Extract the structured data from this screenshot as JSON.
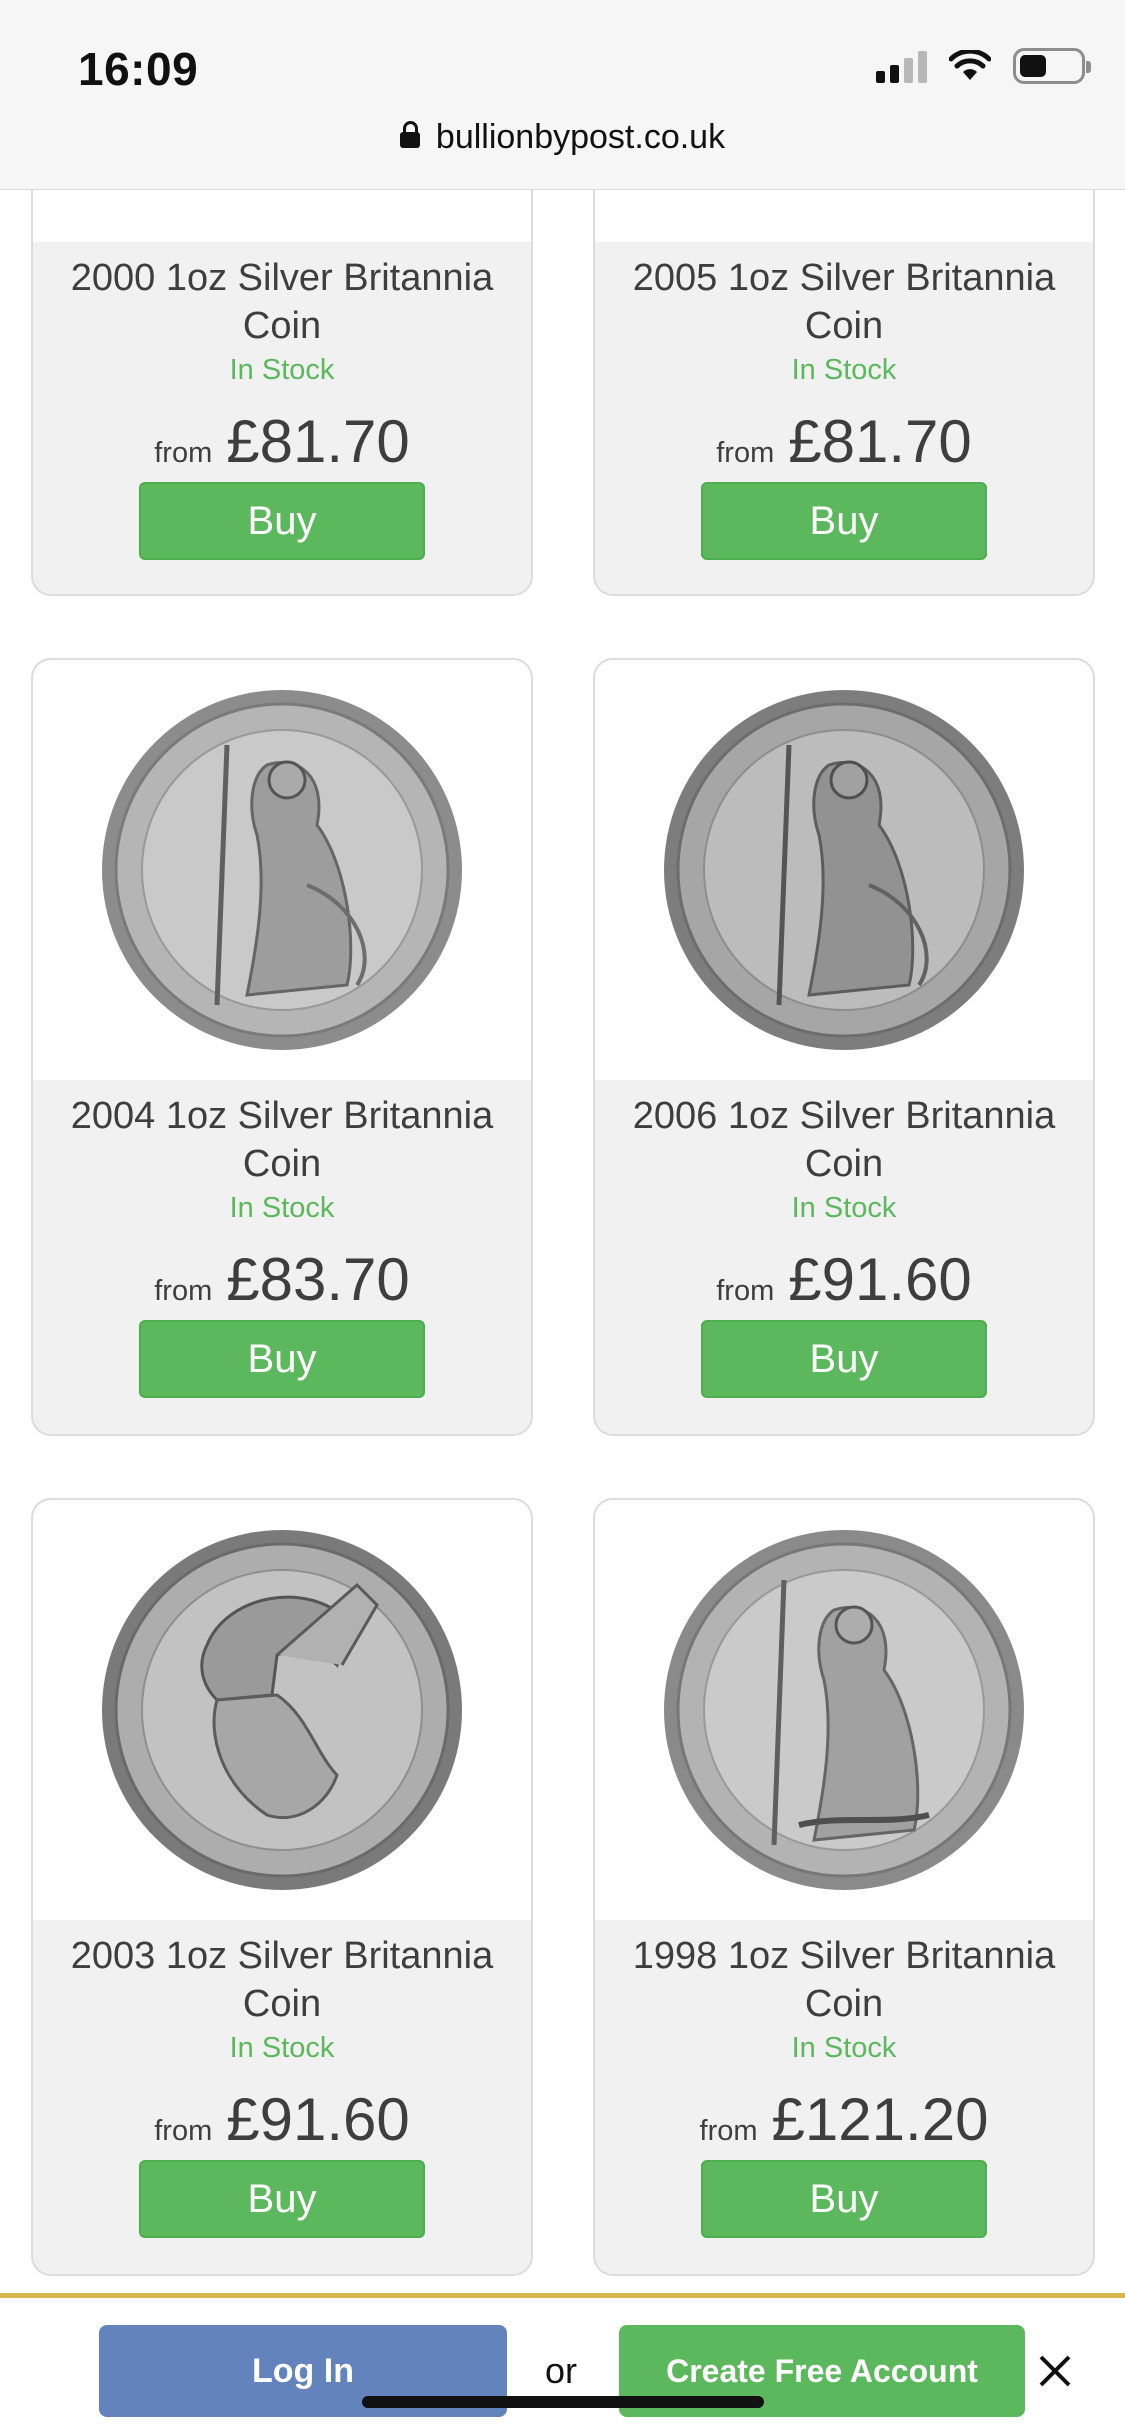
{
  "status_bar": {
    "time": "16:09"
  },
  "browser": {
    "url": "bullionbypost.co.uk"
  },
  "products": [
    {
      "title": "2000 1oz Silver Britannia Coin",
      "stock": "In Stock",
      "from_label": "from",
      "price": "£81.70",
      "buy_label": "Buy",
      "image": "britannia-standing-coin"
    },
    {
      "title": "2005 1oz Silver Britannia Coin",
      "stock": "In Stock",
      "from_label": "from",
      "price": "£81.70",
      "buy_label": "Buy",
      "image": "britannia-standing-coin"
    },
    {
      "title": "2004 1oz Silver Britannia Coin",
      "stock": "In Stock",
      "from_label": "from",
      "price": "£83.70",
      "buy_label": "Buy",
      "image": "britannia-standing-coin"
    },
    {
      "title": "2006 1oz Silver Britannia Coin",
      "stock": "In Stock",
      "from_label": "from",
      "price": "£91.60",
      "buy_label": "Buy",
      "image": "britannia-standing-coin"
    },
    {
      "title": "2003 1oz Silver Britannia Coin",
      "stock": "In Stock",
      "from_label": "from",
      "price": "£91.60",
      "buy_label": "Buy",
      "image": "britannia-helmet-coin"
    },
    {
      "title": "1998 1oz Silver Britannia Coin",
      "stock": "In Stock",
      "from_label": "from",
      "price": "£121.20",
      "buy_label": "Buy",
      "image": "britannia-standing-coin"
    }
  ],
  "bottom_bar": {
    "login_label": "Log In",
    "or_label": "or",
    "create_label": "Create Free Account"
  },
  "colors": {
    "accent_green": "#5cb85c",
    "login_blue": "#6283bb",
    "gold_border": "#d6b54c"
  }
}
